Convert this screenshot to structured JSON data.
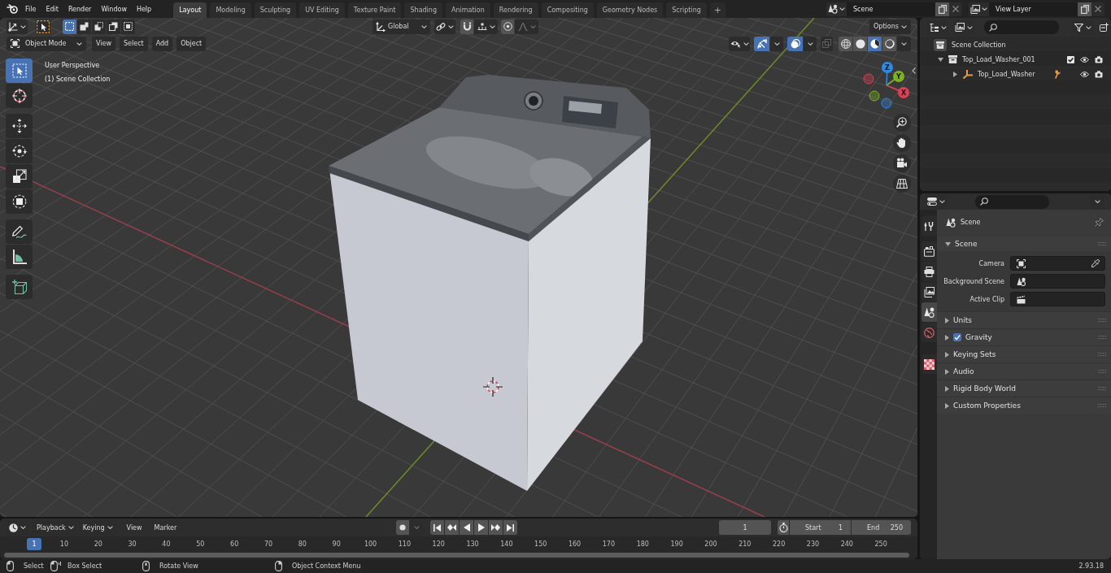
{
  "top_bar": {
    "menus": [
      "File",
      "Edit",
      "Render",
      "Window",
      "Help"
    ],
    "workspaces": [
      {
        "label": "Layout",
        "selected": true
      },
      {
        "label": "Modeling",
        "selected": false
      },
      {
        "label": "Sculpting",
        "selected": false
      },
      {
        "label": "UV Editing",
        "selected": false
      },
      {
        "label": "Texture Paint",
        "selected": false
      },
      {
        "label": "Shading",
        "selected": false
      },
      {
        "label": "Animation",
        "selected": false
      },
      {
        "label": "Rendering",
        "selected": false
      },
      {
        "label": "Compositing",
        "selected": false
      },
      {
        "label": "Geometry Nodes",
        "selected": false
      },
      {
        "label": "Scripting",
        "selected": false
      }
    ],
    "add_workspace": "+",
    "scene": "Scene",
    "view_layer": "View Layer"
  },
  "viewport": {
    "tool_header": {
      "select_modes": [
        {
          "selected": true
        },
        {
          "selected": false
        },
        {
          "selected": false
        },
        {
          "selected": false
        },
        {
          "selected": false
        }
      ],
      "orientation": "Global",
      "snapping": {
        "on": false
      },
      "proportional_editing": {
        "on": false
      },
      "options": "Options"
    },
    "header": {
      "mode": "Object Mode",
      "menus": [
        "View",
        "Select",
        "Add",
        "Object"
      ],
      "gizmos": {
        "on": true
      },
      "overlays": {
        "on": true
      },
      "xray": {
        "on": false
      },
      "shading": [
        {
          "selected": false
        },
        {
          "selected": false
        },
        {
          "selected": true
        },
        {
          "selected": false
        }
      ]
    },
    "tools": [
      [
        {
          "selected": true
        },
        {
          "selected": false
        }
      ],
      [
        {
          "selected": false
        },
        {
          "selected": false
        },
        {
          "selected": false
        },
        {
          "selected": false
        }
      ],
      [
        {
          "selected": false
        },
        {
          "selected": false
        }
      ],
      [
        {
          "selected": false
        }
      ]
    ],
    "info": [
      "User Perspective",
      "(1) Scene Collection"
    ],
    "gizmo_axes": [
      {
        "label": "X",
        "color": "#e33d55"
      },
      {
        "label": "Y",
        "color": "#7cb420"
      },
      {
        "label": "Z",
        "color": "#3188e0"
      }
    ]
  },
  "outliner": {
    "tree": [
      {
        "label": "Scene Collection",
        "children": [
          {
            "label": "Top_Load_Washer_001",
            "expanded": true,
            "checked": true,
            "children": [
              {
                "label": "Top_Load_Washer",
                "expanded": false
              }
            ]
          }
        ]
      }
    ]
  },
  "properties": {
    "tabs": [
      [
        {
          "selected": false
        }
      ],
      [
        {
          "selected": false
        },
        {
          "selected": false
        },
        {
          "selected": false
        },
        {
          "selected": true
        },
        {
          "selected": false
        }
      ],
      [
        {
          "selected": false
        }
      ]
    ],
    "context": "Scene",
    "panels": [
      {
        "title": "Scene",
        "expanded": true,
        "fields": [
          "Camera",
          "Background Scene",
          "Active Clip"
        ]
      },
      {
        "title": "Units",
        "expanded": false
      },
      {
        "title": "Gravity",
        "expanded": false,
        "checked": true
      },
      {
        "title": "Keying Sets",
        "expanded": false
      },
      {
        "title": "Audio",
        "expanded": false
      },
      {
        "title": "Rigid Body World",
        "expanded": false
      },
      {
        "title": "Custom Properties",
        "expanded": false
      }
    ]
  },
  "timeline": {
    "menus": [
      {
        "label": "Playback",
        "dropdown": true
      },
      {
        "label": "Keying",
        "dropdown": true
      },
      {
        "label": "View",
        "dropdown": false
      },
      {
        "label": "Marker",
        "dropdown": false
      }
    ],
    "auto_keying": false,
    "current_frame": "1",
    "start": {
      "label": "Start",
      "value": "1"
    },
    "end": {
      "label": "End",
      "value": "250"
    },
    "ruler": {
      "current": "1",
      "ticks": [
        "10",
        "20",
        "30",
        "40",
        "50",
        "60",
        "70",
        "80",
        "90",
        "100",
        "110",
        "120",
        "130",
        "140",
        "150",
        "160",
        "170",
        "180",
        "190",
        "200",
        "210",
        "220",
        "230",
        "240",
        "250"
      ]
    }
  },
  "status_bar": {
    "hints": [
      "Select",
      "Box Select",
      "Rotate View",
      "Object Context Menu"
    ],
    "version": "2.93.18"
  }
}
